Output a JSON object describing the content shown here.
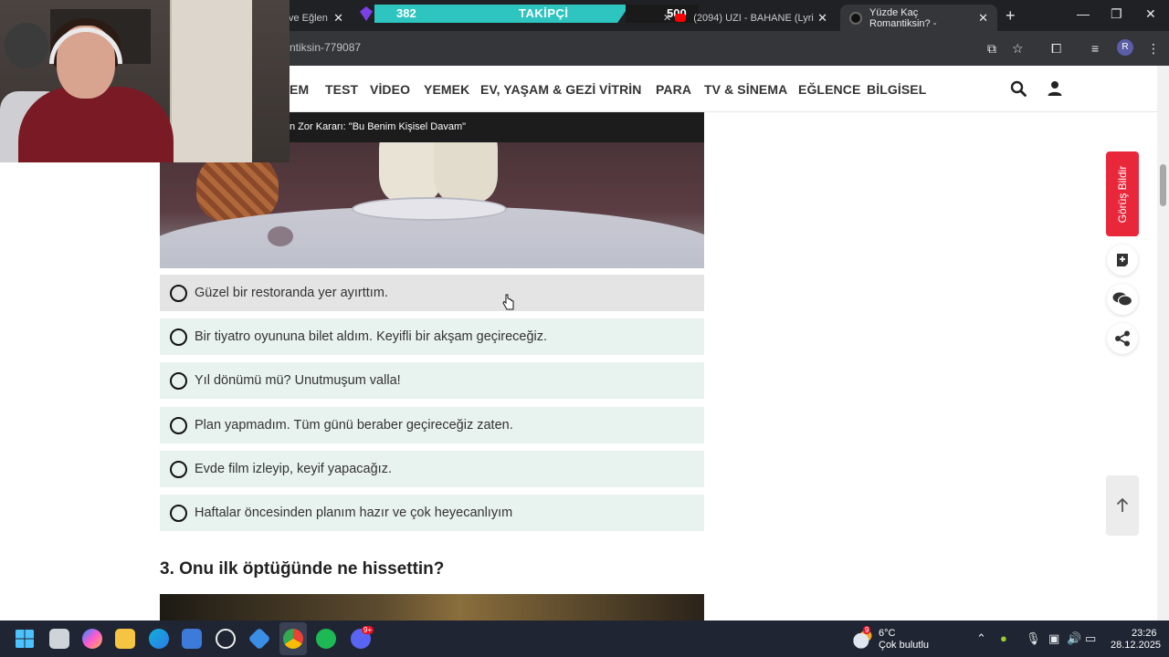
{
  "browser": {
    "tabs": [
      {
        "label": "ve Eğlen",
        "active": false
      },
      {
        "label": "(2094) UZI - BAHANE (Lyri",
        "active": false
      },
      {
        "label": "Yüzde Kaç Romantiksin? -",
        "active": true
      }
    ],
    "follow_goal": {
      "start": "382",
      "label": "TAKİPÇİ",
      "end": "500"
    },
    "url": "ntiksin-779087",
    "profile_initial": "R"
  },
  "nav": {
    "items": [
      "EM",
      "TEST",
      "VİDEO",
      "YEMEK",
      "EV, YAŞAM & GEZİ",
      "VİTRİN",
      "PARA",
      "TV & SİNEMA",
      "EĞLENCE",
      "BİLGİSEL"
    ],
    "icons": [
      "search-icon",
      "user-icon"
    ]
  },
  "ticker": {
    "text": "n Zor Kararı: \"Bu Benim Kişisel Davam\""
  },
  "quiz": {
    "options": [
      "Güzel bir restoranda yer ayırttım.",
      "Bir tiyatro oyununa bilet aldım. Keyifli bir akşam geçireceğiz.",
      "Yıl dönümü mü? Unutmuşum valla!",
      "Plan yapmadım. Tüm günü beraber geçireceğiz zaten.",
      "Evde film izleyip, keyif yapacağız.",
      "Haftalar öncesinden planım hazır ve çok heyecanlıyım"
    ],
    "next_question": "3. Onu ilk öptüğünde ne hissettin?"
  },
  "sidebar": {
    "feedback_label": "Görüş Bildir",
    "icons": [
      "add-note-icon",
      "comments-icon",
      "share-icon",
      "arrow-up-icon"
    ]
  },
  "taskbar": {
    "weather_temp": "6°C",
    "weather_desc": "Çok bulutlu",
    "weather_badge": "9",
    "discord_badge": "9+",
    "time": "23:26",
    "date": "28.12.2025"
  },
  "colors": {
    "option_bg": "#e8f2ee",
    "option_hover_bg": "#e4e4e4",
    "feedback_red": "#e8273a",
    "follow_teal": "#2ec4c0"
  }
}
